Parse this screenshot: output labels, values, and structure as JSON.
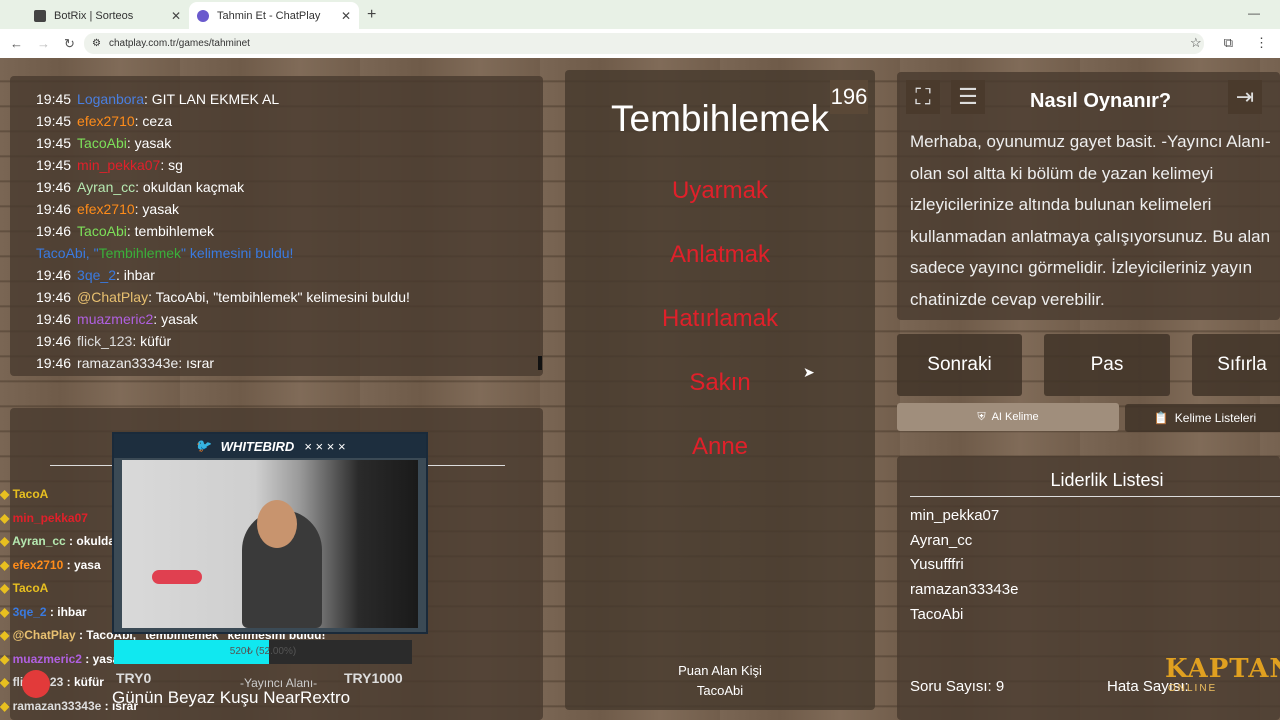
{
  "browser": {
    "tabs": [
      {
        "title": "BotRix | Sorteos",
        "active": false
      },
      {
        "title": "Tahmin Et - ChatPlay",
        "active": true
      }
    ],
    "new_tab": "+",
    "window_min": "—",
    "url": "chatplay.com.tr/games/tahminet"
  },
  "chat": [
    {
      "time": "19:45",
      "user": "Loganbora",
      "color": "#4a7fe0",
      "msg": ": GIT LAN EKMEK AL"
    },
    {
      "time": "19:45",
      "user": "efex2710",
      "color": "#ff8c1a",
      "msg": ": ceza"
    },
    {
      "time": "19:45",
      "user": "TacoAbi",
      "color": "#7de05a",
      "msg": ": yasak"
    },
    {
      "time": "19:45",
      "user": "min_pekka07",
      "color": "#e0202a",
      "msg": ": sg"
    },
    {
      "time": "19:46",
      "user": "Ayran_cc",
      "color": "#b5e8b0",
      "msg": ": okuldan kaçmak"
    },
    {
      "time": "19:46",
      "user": "efex2710",
      "color": "#ff8c1a",
      "msg": ": yasak"
    },
    {
      "time": "19:46",
      "user": "TacoAbi",
      "color": "#7de05a",
      "msg": ": tembihlemek"
    },
    {
      "time": "",
      "user": "TacoAbi, \"",
      "color": "#3a7ae0",
      "msg": "",
      "special": true,
      "word": "Tembihlemek",
      "tail": "\" kelimesini buldu!"
    },
    {
      "time": "19:46",
      "user": "3qe_2",
      "color": "#3a7ae0",
      "msg": ": ihbar"
    },
    {
      "time": "19:46",
      "user": "@ChatPlay",
      "color": "#e8c070",
      "msg": ": TacoAbi, \"tembihlemek\" kelimesini buldu!"
    },
    {
      "time": "19:46",
      "user": "muazmeric2",
      "color": "#b060e0",
      "msg": ": yasak"
    },
    {
      "time": "19:46",
      "user": "flick_123",
      "color": "#ddd",
      "msg": ": küfür"
    },
    {
      "time": "19:46",
      "user": "ramazan33343e",
      "color": "#eee",
      "msg": ": ısrar"
    }
  ],
  "game": {
    "timer": "196",
    "word": "Tembihlemek",
    "forbidden": [
      "Uyarmak",
      "Anlatmak",
      "Hatırlamak",
      "Sakın",
      "Anne"
    ],
    "scorer_label": "Puan Alan Kişi",
    "scorer_name": "TacoAbi"
  },
  "help": {
    "title": "Nasıl Oynanır?",
    "text": "Merhaba, oyunumuz gayet basit. -Yayıncı Alanı-\nolan sol altta ki bölüm de yazan kelimeyi\nizleyicilerinize altında bulunan kelimeleri\nkullanmadan anlatmaya çalışıyorsunuz. Bu alan\nsadece yayıncı görmelidir. İzleyicileriniz yayın\nchatinizde cevap verebilir."
  },
  "buttons": {
    "next": "Sonraki",
    "pass": "Pas",
    "reset": "Sıfırla",
    "ai_word": "AI Kelime",
    "word_lists": "Kelime Listeleri"
  },
  "leaderboard": {
    "title": "Liderlik Listesi",
    "entries": [
      "min_pekka07",
      "Ayran_cc",
      "Yusufffri",
      "ramazan33343e",
      "TacoAbi"
    ],
    "question_count": "Soru Sayısı: 9",
    "error_count": "Hata Sayısı:"
  },
  "overlay": {
    "chat": [
      {
        "user": "TacoA",
        "color": "#e8c020",
        "msg": ""
      },
      {
        "user": "min_pekka07",
        "color": "#e0202a",
        "msg": ""
      },
      {
        "user": "Ayran_cc",
        "color": "#b5e8b0",
        "msg": " : okulda"
      },
      {
        "user": "efex2710",
        "color": "#ff8c1a",
        "msg": " : yasa"
      },
      {
        "user": "TacoA",
        "color": "#e8c020",
        "msg": ""
      },
      {
        "user": "3qe_2",
        "color": "#3a7ae0",
        "msg": " : ihbar"
      },
      {
        "user": "@ChatPlay",
        "color": "#e8c070",
        "msg": " : TacoAbi, \"tembihlemek\" kelimesini buldu!"
      },
      {
        "user": "muazmeric2",
        "color": "#b060e0",
        "msg": " : yasa"
      },
      {
        "user": "flick_123",
        "color": "#ddd",
        "msg": " : küfür"
      },
      {
        "user": "ramazan33343e",
        "color": "#ddd",
        "msg": " : ısrar"
      }
    ],
    "cam_brand": "WHITEBIRD",
    "cam_marks": "× × × ×",
    "progress_text": "520₺ (52.00%)",
    "progress_fraction": 0.52,
    "goal_start": "TRY0",
    "goal_end": "TRY1000",
    "stream_label": "-Yayıncı Alanı-",
    "caption": "Günün Beyaz Kuşu NearRextro",
    "logo_text": "KAPTAN",
    "logo_sub": "ONLINE"
  },
  "colors": {
    "forbidden": "#e0202a",
    "accent_cyan": "#10e8f0"
  }
}
